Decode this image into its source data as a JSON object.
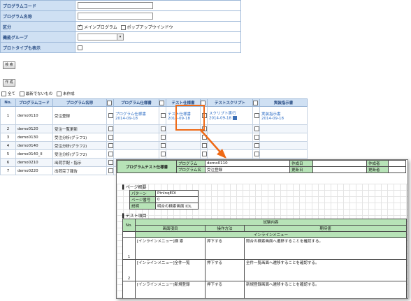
{
  "form": {
    "program_code_label": "プログラムコード",
    "program_name_label": "プログラム名称",
    "category_label": "区分",
    "category_opt1": "メインプログラム",
    "category_opt2": "ポップアップウインドウ",
    "group_label": "機能グループ",
    "group_select_value": "",
    "prototype_label": "プロトタイプも表示"
  },
  "buttons": {
    "search": "検 索",
    "create": "作 成"
  },
  "filters": {
    "all": "全て",
    "not_latest": "最新でないもの",
    "not_created": "未作成"
  },
  "table": {
    "headers": [
      "No.",
      "プログラムコード",
      "プログラム名称",
      "",
      "プログラム仕様書",
      "",
      "テスト仕様書",
      "",
      "テストスクリプト",
      "",
      "実装指示書"
    ],
    "rows": [
      {
        "no": "1",
        "code": "demo0110",
        "name": "受注登録",
        "spec": "プログラム仕様書",
        "spec_date": "2014-09-18",
        "test": "テスト仕様書",
        "test_date": "2014-09-18",
        "script": "スクリプト実行",
        "script_date": "2014-09-18",
        "impl": "実装指示書",
        "impl_date": "2014-09-18"
      },
      {
        "no": "2",
        "code": "demo0120",
        "name": "受注一覧更新",
        "spec": "",
        "spec_date": "",
        "test": "",
        "test_date": "",
        "script": "",
        "script_date": "",
        "impl": "",
        "impl_date": ""
      },
      {
        "no": "3",
        "code": "demo0130",
        "name": "受注分析(グラフ1)",
        "spec": "",
        "spec_date": "",
        "test": "",
        "test_date": "",
        "script": "",
        "script_date": "",
        "impl": "",
        "impl_date": ""
      },
      {
        "no": "4",
        "code": "demo0140",
        "name": "受注分析(グラフ2)",
        "spec": "",
        "spec_date": "",
        "test": "",
        "test_date": "",
        "script": "",
        "script_date": "",
        "impl": "",
        "impl_date": ""
      },
      {
        "no": "5",
        "code": "demo0140_II",
        "name": "受注分析(グラフ2)",
        "spec": "",
        "spec_date": "",
        "test": "",
        "test_date": "",
        "script": "",
        "script_date": "",
        "impl": "",
        "impl_date": ""
      },
      {
        "no": "6",
        "code": "demo0210",
        "name": "出荷手配・指示",
        "spec": "",
        "spec_date": "",
        "test": "",
        "test_date": "",
        "script": "",
        "script_date": "",
        "impl": "",
        "impl_date": ""
      },
      {
        "no": "7",
        "code": "demo0220",
        "name": "出荷完了報告",
        "spec": "",
        "spec_date": "",
        "test": "",
        "test_date": "",
        "script": "",
        "script_date": "",
        "impl": "",
        "impl_date": ""
      }
    ]
  },
  "doc": {
    "title": "プログラムテスト仕様書",
    "program_label": "プログラム",
    "program_value": "demo0110",
    "program_name_label": "プログラム名",
    "program_name_value": "受注登録",
    "created_label": "作成日",
    "creator_label": "作成者",
    "updated_label": "更新日",
    "updater_label": "更新者",
    "page_section": "ページ概要",
    "pattern_label": "パターン",
    "pattern_value": "PtnInqEDI",
    "page_no_label": "ページ番号",
    "page_no_value": "0",
    "desc_label": "説明",
    "desc_value": "明合の検索画面 IDL",
    "test_section": "テスト項目",
    "col_no": "No.",
    "col_content": "試験内容",
    "col_screen": "画面項目",
    "col_op": "操作方法",
    "col_expected": "期待値",
    "menu_group": "インラインメニュー",
    "rows": [
      {
        "no": "1",
        "item": "[インラインメニュー]検 索",
        "op": "押下する",
        "exp": "照合の検索画面へ遷移することを確認する。"
      },
      {
        "no": "2",
        "item": "[インラインメニュー]全件一覧",
        "op": "押下する",
        "exp": "全件一覧画面へ遷移することを確認する。"
      },
      {
        "no": "3",
        "item": "[インラインメニュー]新規登録",
        "op": "押下する",
        "exp": "新規登録画面へ遷移することを確認する。"
      }
    ]
  },
  "colors": {
    "accent": "#ef6a16",
    "header_bg": "#cfe0f3",
    "doc_green": "#b7e3b7"
  }
}
